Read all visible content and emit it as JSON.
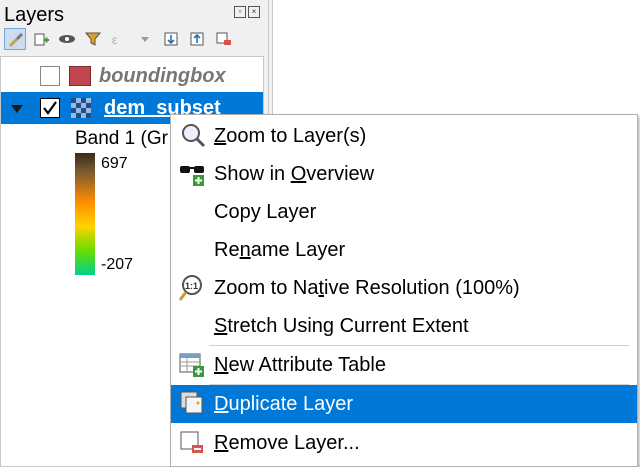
{
  "panel": {
    "title": "Layers",
    "controls": [
      "float-icon",
      "close-icon"
    ],
    "toolbar": [
      "open-layer-styling-icon",
      "add-group-icon",
      "manage-visibility-icon",
      "filter-legend-icon",
      "filter-expression-icon",
      "expand-all-icon",
      "collapse-all-icon",
      "remove-layer-icon"
    ]
  },
  "tree": {
    "layers": [
      {
        "name": "boundingbox",
        "checked": false,
        "swatch": "#c0474f",
        "selected": false
      },
      {
        "name": "dem_subset",
        "checked": true,
        "selected": true
      }
    ],
    "legend": {
      "band_label": "Band 1 (Gr",
      "max": "697",
      "min": "-207"
    }
  },
  "context_menu": {
    "items": [
      {
        "pre": "",
        "u": "Z",
        "post": "oom to Layer(s)",
        "icon": "zoom-layer-icon"
      },
      {
        "pre": "Show in ",
        "u": "O",
        "post": "verview",
        "icon": "overview-glasses-icon"
      },
      {
        "pre": "Copy Layer",
        "u": "",
        "post": "",
        "icon": ""
      },
      {
        "pre": "Re",
        "u": "n",
        "post": "ame Layer",
        "icon": ""
      },
      {
        "pre": "Zoom to Na",
        "u": "t",
        "post": "ive Resolution (100%)",
        "icon": "zoom-native-icon"
      },
      {
        "pre": "",
        "u": "S",
        "post": "tretch Using Current Extent",
        "icon": ""
      },
      {
        "pre": "",
        "u": "N",
        "post": "ew Attribute Table",
        "icon": "attribute-table-icon"
      },
      {
        "pre": "",
        "u": "D",
        "post": "uplicate Layer",
        "icon": "duplicate-layer-icon"
      },
      {
        "pre": "",
        "u": "R",
        "post": "emove Layer...",
        "icon": "remove-layer-icon"
      }
    ],
    "highlighted_index": 7
  },
  "colors": {
    "selection": "#0078d7",
    "boundingbox_swatch": "#c0474f"
  }
}
